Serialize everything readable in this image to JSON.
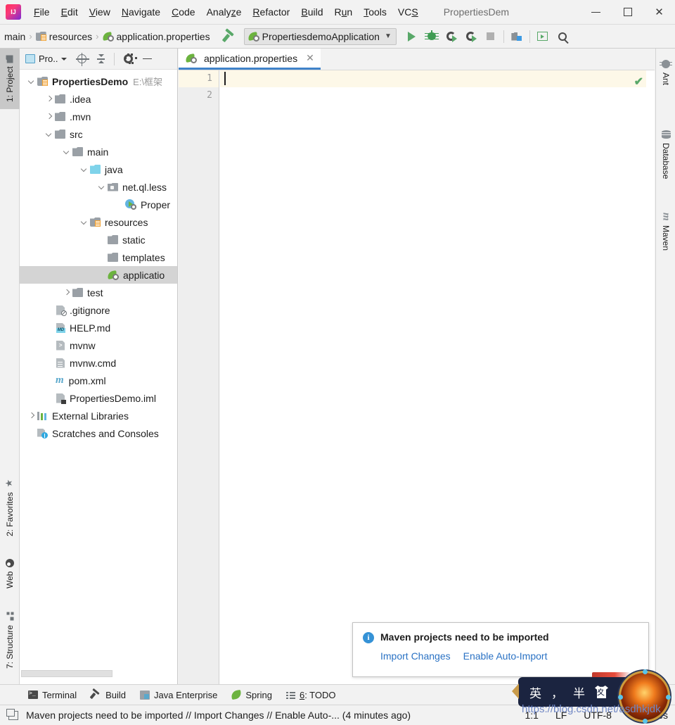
{
  "window": {
    "title": "PropertiesDem",
    "minimize_label": "—",
    "maximize_label": "□",
    "close_label": "✕"
  },
  "menubar": {
    "logo": "intellij-idea-logo",
    "items": [
      {
        "label": "File",
        "mnemonic": "F"
      },
      {
        "label": "Edit",
        "mnemonic": "E"
      },
      {
        "label": "View",
        "mnemonic": "V"
      },
      {
        "label": "Navigate",
        "mnemonic": "N"
      },
      {
        "label": "Code",
        "mnemonic": "C"
      },
      {
        "label": "Analyze",
        "mnemonic": "z"
      },
      {
        "label": "Refactor",
        "mnemonic": "R"
      },
      {
        "label": "Build",
        "mnemonic": "B"
      },
      {
        "label": "Run",
        "mnemonic": "u"
      },
      {
        "label": "Tools",
        "mnemonic": "T"
      },
      {
        "label": "VCS",
        "mnemonic": "S"
      }
    ]
  },
  "navbar": {
    "breadcrumbs": [
      {
        "label": "main",
        "icon": "none"
      },
      {
        "label": "resources",
        "icon": "resources-folder-icon"
      },
      {
        "label": "application.properties",
        "icon": "spring-properties-icon"
      }
    ],
    "separator": "›",
    "build_button": "build-hammer-icon",
    "run_config": {
      "label": "PropertiesdemoApplication",
      "icon": "spring-boot-icon",
      "chevron": "⌄"
    },
    "buttons": [
      {
        "name": "run-button",
        "icon": "run-triangle-icon"
      },
      {
        "name": "debug-button",
        "icon": "debug-bug-icon"
      },
      {
        "name": "run-with-coverage-button",
        "icon": "coverage-icon"
      },
      {
        "name": "profile-button",
        "icon": "profiler-icon"
      },
      {
        "name": "stop-button",
        "icon": "stop-square-icon"
      },
      {
        "name": "project-structure-button",
        "icon": "project-structure-icon"
      },
      {
        "name": "update-running-app-button",
        "icon": "green-box-icon"
      },
      {
        "name": "search-everywhere-button",
        "icon": "search-icon"
      }
    ]
  },
  "left_stripe": {
    "tabs": [
      {
        "label": "1: Project",
        "mnemonic": "1",
        "icon": "project-folder-icon",
        "active": true
      },
      {
        "label": "2: Favorites",
        "mnemonic": "2",
        "icon": "star-icon",
        "active": false
      },
      {
        "label": "Web",
        "mnemonic": "",
        "icon": "web-globe-icon",
        "active": false
      },
      {
        "label": "7: Structure",
        "mnemonic": "7",
        "icon": "structure-icon",
        "active": false
      }
    ]
  },
  "right_stripe": {
    "tabs": [
      {
        "label": "Ant",
        "icon": "ant-icon"
      },
      {
        "label": "Database",
        "icon": "database-icon"
      },
      {
        "label": "Maven",
        "icon": "maven-icon"
      }
    ]
  },
  "project_panel": {
    "selector_label": "Pro..",
    "toolbar_buttons": [
      {
        "name": "select-opened-file-button",
        "icon": "locate-target-icon"
      },
      {
        "name": "collapse-all-button",
        "icon": "collapse-all-icon"
      },
      {
        "name": "settings-button",
        "icon": "gear-icon"
      },
      {
        "name": "hide-button",
        "icon": "minimize-icon"
      }
    ],
    "tree": [
      {
        "label": "PropertiesDemo",
        "path": "E:\\框架",
        "depth": 0,
        "arrow": "down",
        "icon": "module-folder-icon",
        "bold": true,
        "selected": false
      },
      {
        "label": ".idea",
        "path": "",
        "depth": 1,
        "arrow": "right",
        "icon": "folder-icon",
        "bold": false,
        "selected": false
      },
      {
        "label": ".mvn",
        "path": "",
        "depth": 1,
        "arrow": "right",
        "icon": "folder-icon",
        "bold": false,
        "selected": false
      },
      {
        "label": "src",
        "path": "",
        "depth": 1,
        "arrow": "down",
        "icon": "folder-icon",
        "bold": false,
        "selected": false
      },
      {
        "label": "main",
        "path": "",
        "depth": 2,
        "arrow": "down",
        "icon": "folder-icon",
        "bold": false,
        "selected": false
      },
      {
        "label": "java",
        "path": "",
        "depth": 3,
        "arrow": "down",
        "icon": "sources-folder-icon",
        "bold": false,
        "selected": false
      },
      {
        "label": "net.ql.less",
        "path": "",
        "depth": 4,
        "arrow": "down",
        "icon": "package-icon",
        "bold": false,
        "selected": false
      },
      {
        "label": "Proper",
        "path": "",
        "depth": 5,
        "arrow": "none",
        "icon": "spring-class-icon",
        "bold": false,
        "selected": false
      },
      {
        "label": "resources",
        "path": "",
        "depth": 3,
        "arrow": "down",
        "icon": "resources-folder-icon",
        "bold": false,
        "selected": false
      },
      {
        "label": "static",
        "path": "",
        "depth": 4,
        "arrow": "none",
        "icon": "folder-icon",
        "bold": false,
        "selected": false
      },
      {
        "label": "templates",
        "path": "",
        "depth": 4,
        "arrow": "none",
        "icon": "folder-icon",
        "bold": false,
        "selected": false
      },
      {
        "label": "applicatio",
        "path": "",
        "depth": 4,
        "arrow": "none",
        "icon": "spring-properties-icon",
        "bold": false,
        "selected": true
      },
      {
        "label": "test",
        "path": "",
        "depth": 2,
        "arrow": "right",
        "icon": "folder-icon",
        "bold": false,
        "selected": false
      },
      {
        "label": ".gitignore",
        "path": "",
        "depth": 1,
        "arrow": "none",
        "icon": "gitignore-file-icon",
        "bold": false,
        "selected": false
      },
      {
        "label": "HELP.md",
        "path": "",
        "depth": 1,
        "arrow": "none",
        "icon": "markdown-file-icon",
        "bold": false,
        "selected": false
      },
      {
        "label": "mvnw",
        "path": "",
        "depth": 1,
        "arrow": "none",
        "icon": "shell-script-icon",
        "bold": false,
        "selected": false
      },
      {
        "label": "mvnw.cmd",
        "path": "",
        "depth": 1,
        "arrow": "none",
        "icon": "cmd-file-icon",
        "bold": false,
        "selected": false
      },
      {
        "label": "pom.xml",
        "path": "",
        "depth": 1,
        "arrow": "none",
        "icon": "maven-pom-icon",
        "bold": false,
        "selected": false
      },
      {
        "label": "PropertiesDemo.iml",
        "path": "",
        "depth": 1,
        "arrow": "none",
        "icon": "iml-file-icon",
        "bold": false,
        "selected": false
      },
      {
        "label": "External Libraries",
        "path": "",
        "depth": 0,
        "arrow": "right",
        "icon": "libraries-icon",
        "bold": false,
        "selected": false
      },
      {
        "label": "Scratches and Consoles",
        "path": "",
        "depth": 0,
        "arrow": "none",
        "icon": "scratches-icon",
        "bold": false,
        "selected": false
      }
    ]
  },
  "editor": {
    "tab": {
      "label": "application.properties",
      "icon": "spring-properties-icon",
      "close": "✕"
    },
    "line_numbers": [
      "1",
      "2"
    ],
    "lines": [
      "",
      ""
    ],
    "current_line": 1,
    "inspection_status": "✔"
  },
  "notification": {
    "icon": "info-icon",
    "title": "Maven projects need to be imported",
    "actions": [
      {
        "label": "Import Changes"
      },
      {
        "label": "Enable Auto-Import"
      }
    ]
  },
  "bottom_bar": {
    "items": [
      {
        "label": "Terminal",
        "icon": "terminal-icon",
        "mnemonic": ""
      },
      {
        "label": "Build",
        "icon": "build-hammer-icon",
        "mnemonic": ""
      },
      {
        "label": "Java Enterprise",
        "icon": "java-enterprise-icon",
        "mnemonic": ""
      },
      {
        "label": "Spring",
        "icon": "spring-leaf-icon",
        "mnemonic": ""
      },
      {
        "label": "6: TODO",
        "icon": "todo-list-icon",
        "mnemonic": "6"
      }
    ]
  },
  "status_bar": {
    "icon": "event-log-icon",
    "message": "Maven projects need to be imported // Import Changes // Enable Auto-... (4 minutes ago)",
    "caret_position": "1:1",
    "line_separator": "LF",
    "encoding": "UTF-8",
    "indent": "4 spaces"
  },
  "ime_bar": {
    "mode": "英",
    "punctuation": "，",
    "width_mode": "半",
    "skin_icon": "shirt-icon",
    "avatar": "avatar-icon"
  },
  "watermark": {
    "text": "https://blog.csdn.net/asdhkjdk"
  },
  "colors": {
    "accent": "#4083c9",
    "selection": "#d4d4d4",
    "current_line": "#fdf8e8",
    "link": "#2a72c4",
    "green": "#59a869"
  }
}
